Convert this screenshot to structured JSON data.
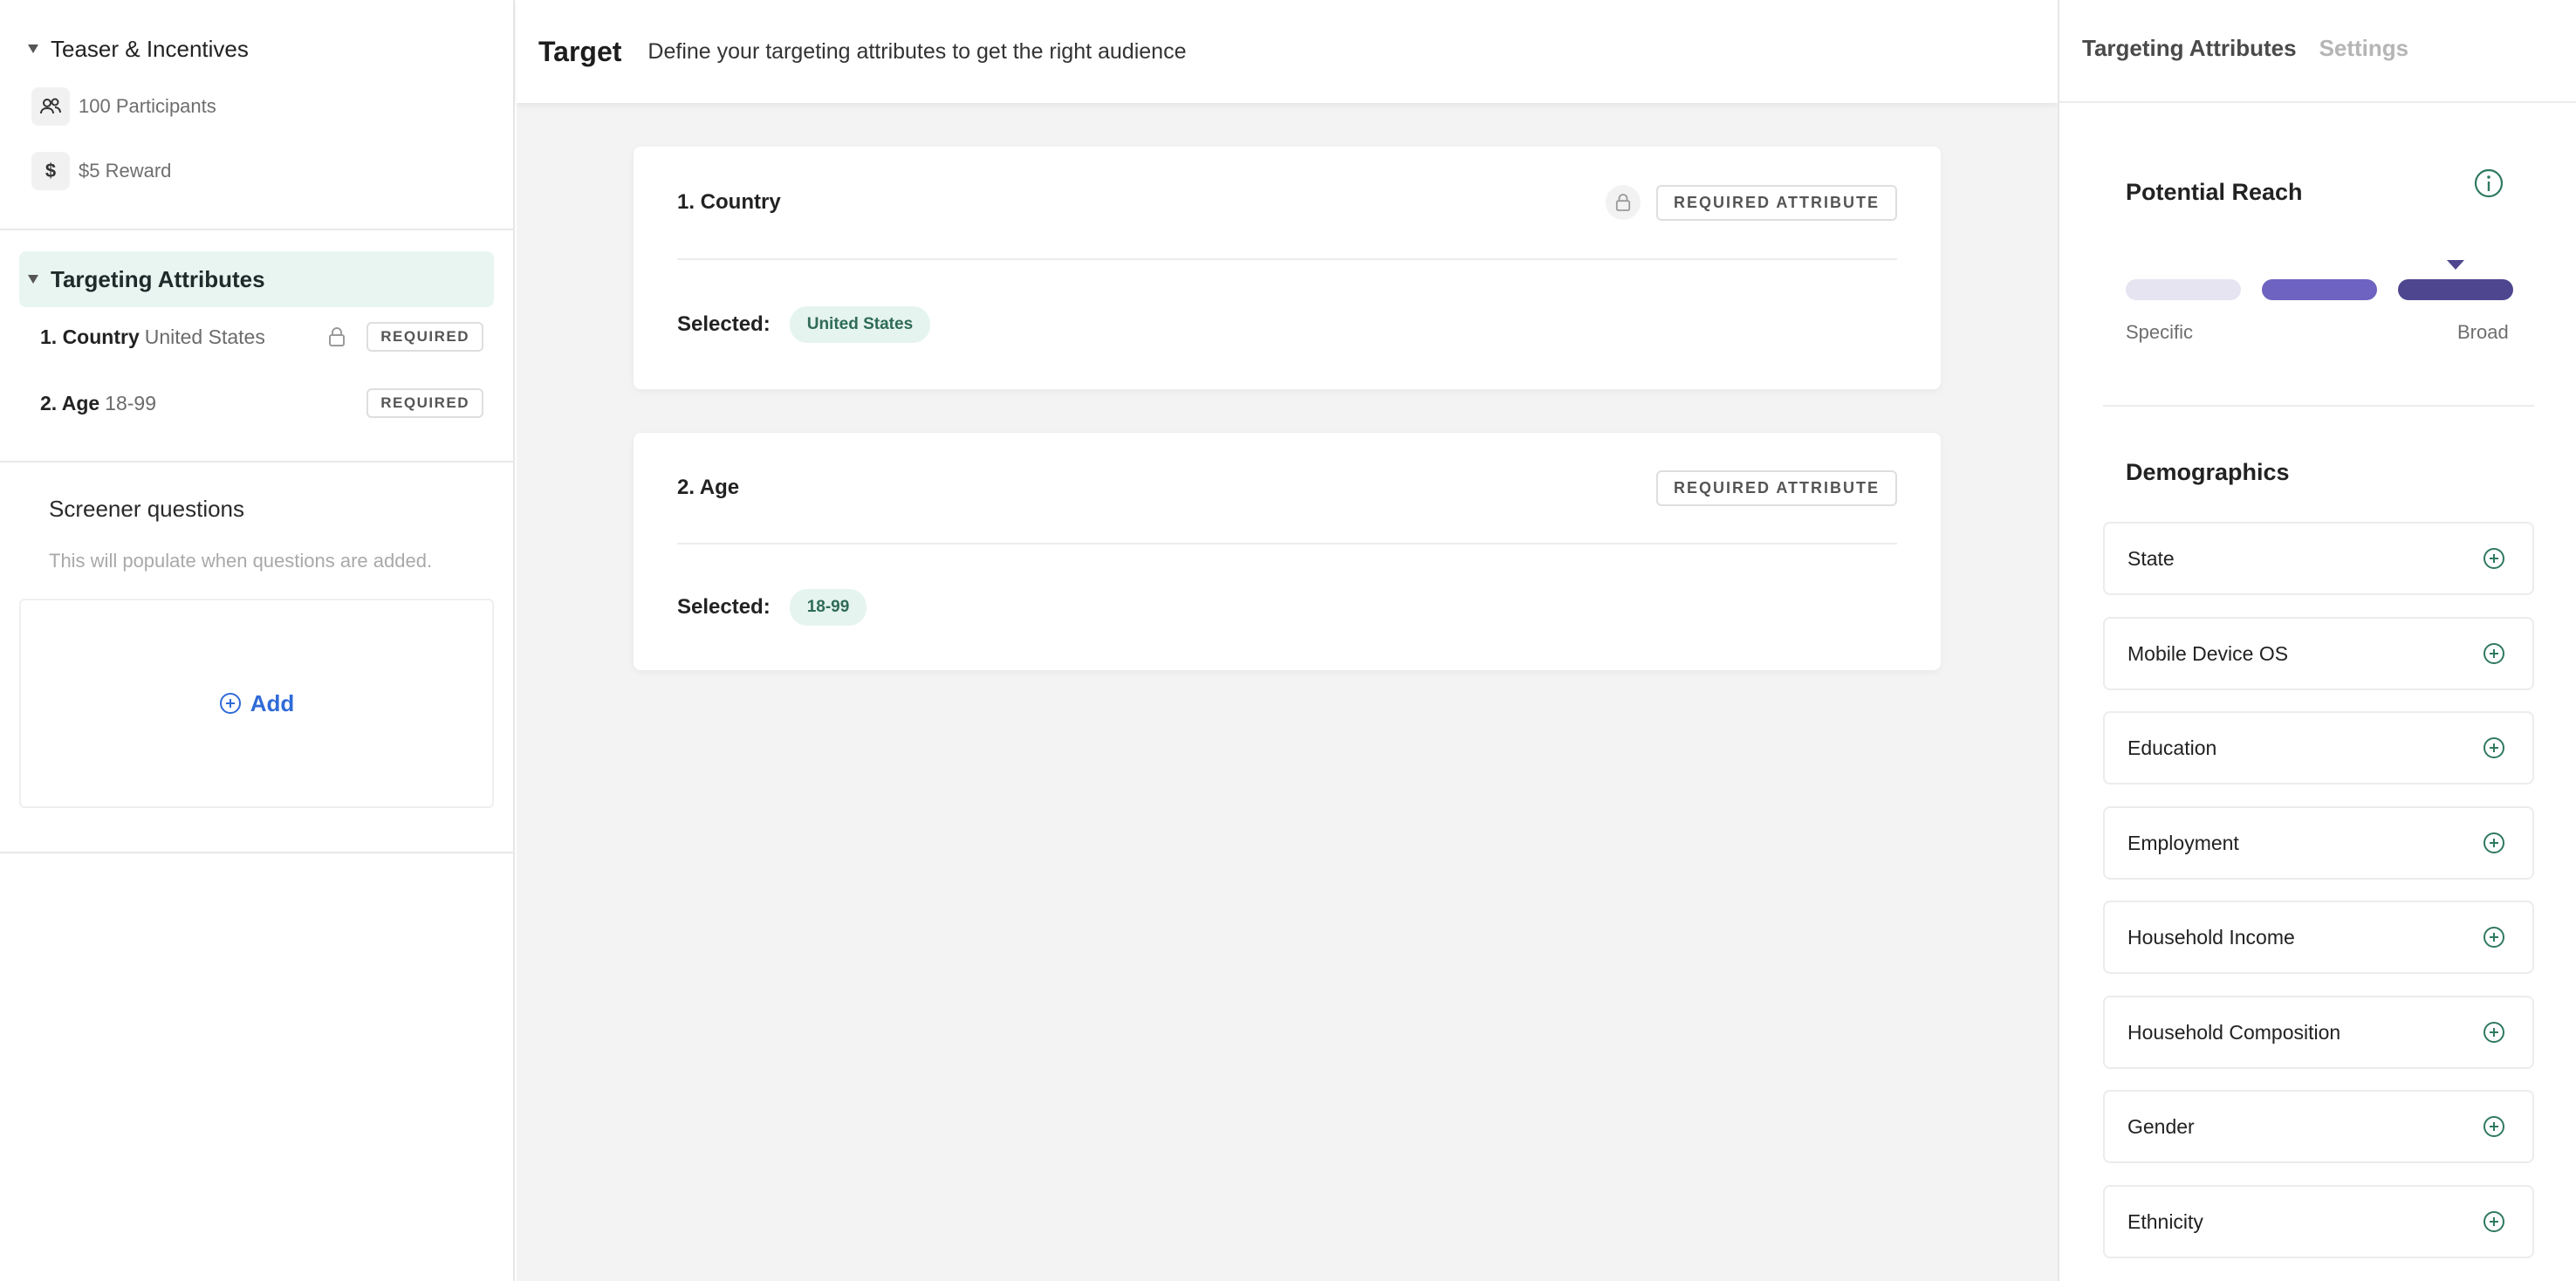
{
  "left": {
    "teaser_title": "Teaser & Incentives",
    "participants": "100 Participants",
    "reward_symbol": "$",
    "reward": "$5 Reward",
    "targeting_title": "Targeting Attributes",
    "attributes": [
      {
        "num": "1. Country",
        "value": "United States",
        "locked": true,
        "badge": "REQUIRED"
      },
      {
        "num": "2. Age",
        "value": "18-99",
        "locked": false,
        "badge": "REQUIRED"
      }
    ],
    "screener_title": "Screener questions",
    "screener_sub": "This will populate when questions are added.",
    "add_label": "Add"
  },
  "header": {
    "title": "Target",
    "subtitle": "Define your targeting attributes to get the right audience"
  },
  "cards": [
    {
      "name": "1. Country",
      "badge": "REQUIRED ATTRIBUTE",
      "selected_label": "Selected:",
      "selected": "United States"
    },
    {
      "name": "2. Age",
      "badge": "REQUIRED ATTRIBUTE",
      "selected_label": "Selected:",
      "selected": "18-99"
    }
  ],
  "right": {
    "tabs": {
      "active": "Targeting Attributes",
      "inactive": "Settings"
    },
    "reach": {
      "title": "Potential Reach",
      "scale_left": "Specific",
      "scale_right": "Broad",
      "bar_colors": [
        "#e6e4f1",
        "#6e63c0",
        "#4e468f"
      ],
      "level_index": 2
    },
    "demographics_title": "Demographics",
    "demographics": [
      "State",
      "Mobile Device OS",
      "Education",
      "Employment",
      "Household Income",
      "Household Composition",
      "Gender",
      "Ethnicity"
    ]
  },
  "colors": {
    "accent_green": "#2f7a5e",
    "link_blue": "#2f6bd8",
    "purple": "#4e468f"
  }
}
